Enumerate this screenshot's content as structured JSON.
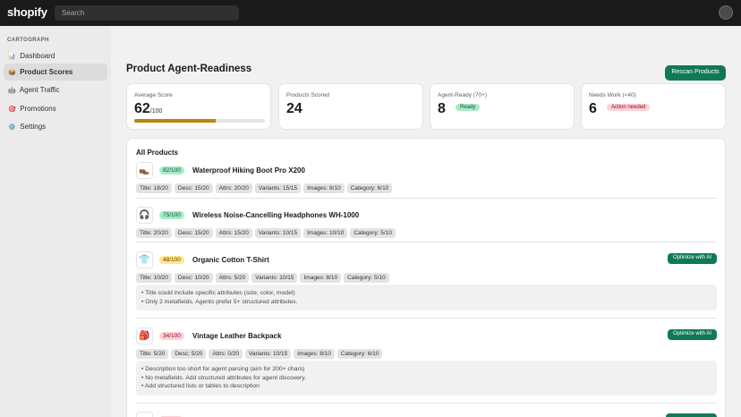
{
  "topbar": {
    "logo": "shopify",
    "search_placeholder": "Search"
  },
  "sidebar": {
    "heading": "CARTOGRAPH",
    "items": [
      {
        "icon": "📊",
        "label": "Dashboard",
        "active": false
      },
      {
        "icon": "📦",
        "label": "Product Scores",
        "active": true
      },
      {
        "icon": "🤖",
        "label": "Agent Traffic",
        "active": false
      },
      {
        "icon": "🎯",
        "label": "Promotions",
        "active": false
      },
      {
        "icon": "⚙️",
        "label": "Settings",
        "active": false
      }
    ]
  },
  "page": {
    "title": "Product Agent-Readiness",
    "rescan_label": "Rescan Products"
  },
  "stats": {
    "average": {
      "label": "Average Score",
      "value": "62",
      "suffix": "/100",
      "progress": 0.62
    },
    "scored": {
      "label": "Products Scored",
      "value": "24"
    },
    "ready": {
      "label": "Agent-Ready (70+)",
      "value": "8",
      "badge": "Ready"
    },
    "needs": {
      "label": "Needs Work (<40)",
      "value": "6",
      "badge": "Action needed"
    }
  },
  "products": {
    "heading": "All Products",
    "optimize_label": "Optimize with AI",
    "items": [
      {
        "icon": "👞",
        "score": "82/100",
        "level": "green",
        "name": "Waterproof Hiking Boot Pro X200",
        "tags": [
          "Title: 18/20",
          "Desc: 15/20",
          "Attrs: 20/20",
          "Variants: 15/15",
          "Images: 8/10",
          "Category: 6/10"
        ],
        "issues": []
      },
      {
        "icon": "🎧",
        "score": "75/100",
        "level": "green",
        "name": "Wireless Noise-Cancelling Headphones WH-1000",
        "tags": [
          "Title: 20/20",
          "Desc: 15/20",
          "Attrs: 15/20",
          "Variants: 10/15",
          "Images: 10/10",
          "Category: 5/10"
        ],
        "issues": []
      },
      {
        "icon": "👕",
        "score": "48/100",
        "level": "yellow",
        "name": "Organic Cotton T-Shirt",
        "tags": [
          "Title: 10/20",
          "Desc: 10/20",
          "Attrs: 5/20",
          "Variants: 10/15",
          "Images: 8/10",
          "Category: 5/10"
        ],
        "issues": [
          "• Title could include specific attributes (size, color, model)",
          "• Only 2 metafields. Agents prefer 5+ structured attributes."
        ]
      },
      {
        "icon": "🎒",
        "score": "34/100",
        "level": "red",
        "name": "Vintage Leather Backpack",
        "tags": [
          "Title: 5/20",
          "Desc: 5/20",
          "Attrs: 0/20",
          "Variants: 10/15",
          "Images: 8/10",
          "Category: 6/10"
        ],
        "issues": [
          "• Description too short for agent parsing (aim for 200+ chars)",
          "• No metafields. Add structured attributes for agent discovery.",
          "• Add structured lists or tables to description"
        ]
      }
    ]
  },
  "colors": {
    "brand": "#0f7a55",
    "topbar": "#1a1a1a",
    "progress": "#b8860b"
  }
}
